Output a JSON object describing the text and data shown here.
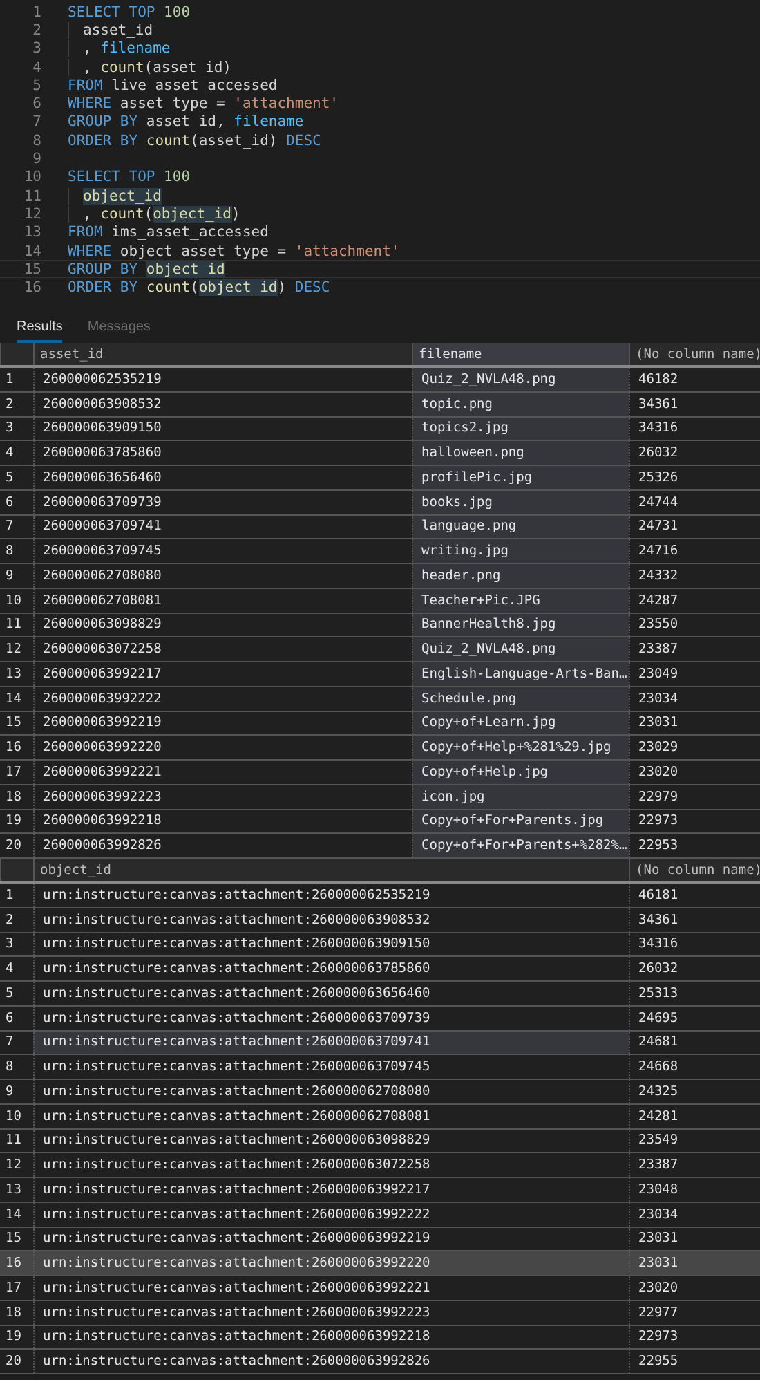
{
  "editor": {
    "lines": [
      {
        "number": "1",
        "current": false,
        "indented": false,
        "tokens": [
          {
            "kind": "kw",
            "text": "SELECT TOP "
          },
          {
            "kind": "num",
            "text": "100"
          }
        ]
      },
      {
        "number": "2",
        "current": false,
        "indented": true,
        "tokens": [
          {
            "kind": "plain",
            "text": "asset_id"
          }
        ]
      },
      {
        "number": "3",
        "current": false,
        "indented": true,
        "tokens": [
          {
            "kind": "plain",
            "text": ", "
          },
          {
            "kind": "col",
            "text": "filename"
          }
        ]
      },
      {
        "number": "4",
        "current": false,
        "indented": true,
        "tokens": [
          {
            "kind": "plain",
            "text": ", "
          },
          {
            "kind": "fn",
            "text": "count"
          },
          {
            "kind": "plain",
            "text": "(asset_id)"
          }
        ]
      },
      {
        "number": "5",
        "current": false,
        "indented": false,
        "tokens": [
          {
            "kind": "kw",
            "text": "FROM"
          },
          {
            "kind": "plain",
            "text": " live_asset_accessed"
          }
        ]
      },
      {
        "number": "6",
        "current": false,
        "indented": false,
        "tokens": [
          {
            "kind": "kw",
            "text": "WHERE"
          },
          {
            "kind": "plain",
            "text": " asset_type = "
          },
          {
            "kind": "str",
            "text": "'attachment'"
          }
        ]
      },
      {
        "number": "7",
        "current": false,
        "indented": false,
        "tokens": [
          {
            "kind": "kw",
            "text": "GROUP BY"
          },
          {
            "kind": "plain",
            "text": " asset_id, "
          },
          {
            "kind": "col",
            "text": "filename"
          }
        ]
      },
      {
        "number": "8",
        "current": false,
        "indented": false,
        "tokens": [
          {
            "kind": "kw",
            "text": "ORDER BY "
          },
          {
            "kind": "fn",
            "text": "count"
          },
          {
            "kind": "plain",
            "text": "(asset_id) "
          },
          {
            "kind": "kw",
            "text": "DESC"
          }
        ]
      },
      {
        "number": "9",
        "current": false
      },
      {
        "number": "10",
        "current": false,
        "indented": false,
        "tokens": [
          {
            "kind": "kw",
            "text": "SELECT TOP "
          },
          {
            "kind": "num",
            "text": "100"
          }
        ]
      },
      {
        "number": "11",
        "current": false,
        "indented": true,
        "tokens": [
          {
            "kind": "ref",
            "text": "object_id"
          }
        ]
      },
      {
        "number": "12",
        "current": false,
        "indented": true,
        "tokens": [
          {
            "kind": "plain",
            "text": ", "
          },
          {
            "kind": "fn",
            "text": "count"
          },
          {
            "kind": "plain",
            "text": "("
          },
          {
            "kind": "ref",
            "text": "object_id"
          },
          {
            "kind": "plain",
            "text": ")"
          }
        ]
      },
      {
        "number": "13",
        "current": false,
        "indented": false,
        "tokens": [
          {
            "kind": "kw",
            "text": "FROM"
          },
          {
            "kind": "plain",
            "text": " ims_asset_accessed"
          }
        ]
      },
      {
        "number": "14",
        "current": false,
        "indented": false,
        "tokens": [
          {
            "kind": "kw",
            "text": "WHERE"
          },
          {
            "kind": "plain",
            "text": " object_asset_type = "
          },
          {
            "kind": "str",
            "text": "'attachment'"
          }
        ]
      },
      {
        "number": "15",
        "current": true,
        "indented": false,
        "tokens": [
          {
            "kind": "kw",
            "text": "GROUP BY "
          },
          {
            "kind": "ref",
            "text": "object_id"
          }
        ]
      },
      {
        "number": "16",
        "current": false,
        "indented": false,
        "tokens": [
          {
            "kind": "kw",
            "text": "ORDER BY "
          },
          {
            "kind": "fn",
            "text": "count"
          },
          {
            "kind": "plain",
            "text": "("
          },
          {
            "kind": "ref",
            "text": "object_id"
          },
          {
            "kind": "plain",
            "text": ") "
          },
          {
            "kind": "kw",
            "text": "DESC"
          }
        ]
      }
    ]
  },
  "result_tabs": [
    {
      "label": "Results",
      "selected": true
    },
    {
      "label": "Messages",
      "selected": false
    }
  ],
  "result_grids": [
    {
      "columns": [
        {
          "label": "asset_id",
          "selected": false
        },
        {
          "label": "filename",
          "selected": true
        },
        {
          "label": "(No column name)",
          "selected": false
        }
      ],
      "rows": [
        {
          "number": "1",
          "selected": false,
          "hovered": false,
          "cells": [
            "260000062535219",
            "Quiz_2_NVLA48.png",
            "46182"
          ]
        },
        {
          "number": "2",
          "selected": false,
          "hovered": false,
          "cells": [
            "260000063908532",
            "topic.png",
            "34361"
          ]
        },
        {
          "number": "3",
          "selected": false,
          "hovered": false,
          "cells": [
            "260000063909150",
            "topics2.jpg",
            "34316"
          ]
        },
        {
          "number": "4",
          "selected": false,
          "hovered": false,
          "cells": [
            "260000063785860",
            "halloween.png",
            "26032"
          ]
        },
        {
          "number": "5",
          "selected": false,
          "hovered": false,
          "cells": [
            "260000063656460",
            "profilePic.jpg",
            "25326"
          ]
        },
        {
          "number": "6",
          "selected": false,
          "hovered": false,
          "cells": [
            "260000063709739",
            "books.jpg",
            "24744"
          ]
        },
        {
          "number": "7",
          "selected": false,
          "hovered": false,
          "cells": [
            "260000063709741",
            "language.png",
            "24731"
          ]
        },
        {
          "number": "8",
          "selected": false,
          "hovered": false,
          "cells": [
            "260000063709745",
            "writing.jpg",
            "24716"
          ]
        },
        {
          "number": "9",
          "selected": false,
          "hovered": false,
          "cells": [
            "260000062708080",
            "header.png",
            "24332"
          ]
        },
        {
          "number": "10",
          "selected": false,
          "hovered": false,
          "cells": [
            "260000062708081",
            "Teacher+Pic.JPG",
            "24287"
          ]
        },
        {
          "number": "11",
          "selected": false,
          "hovered": false,
          "cells": [
            "260000063098829",
            "BannerHealth8.jpg",
            "23550"
          ]
        },
        {
          "number": "12",
          "selected": false,
          "hovered": false,
          "cells": [
            "260000063072258",
            "Quiz_2_NVLA48.png",
            "23387"
          ]
        },
        {
          "number": "13",
          "selected": false,
          "hovered": false,
          "cells": [
            "260000063992217",
            "English-Language-Arts-Ban…",
            "23049"
          ]
        },
        {
          "number": "14",
          "selected": false,
          "hovered": false,
          "cells": [
            "260000063992222",
            "Schedule.png",
            "23034"
          ]
        },
        {
          "number": "15",
          "selected": false,
          "hovered": false,
          "cells": [
            "260000063992219",
            "Copy+of+Learn.jpg",
            "23031"
          ]
        },
        {
          "number": "16",
          "selected": false,
          "hovered": false,
          "cells": [
            "260000063992220",
            "Copy+of+Help+%281%29.jpg",
            "23029"
          ]
        },
        {
          "number": "17",
          "selected": false,
          "hovered": false,
          "cells": [
            "260000063992221",
            "Copy+of+Help.jpg",
            "23020"
          ]
        },
        {
          "number": "18",
          "selected": false,
          "hovered": false,
          "cells": [
            "260000063992223",
            "icon.jpg",
            "22979"
          ]
        },
        {
          "number": "19",
          "selected": false,
          "hovered": false,
          "cells": [
            "260000063992218",
            "Copy+of+For+Parents.jpg",
            "22973"
          ]
        },
        {
          "number": "20",
          "selected": false,
          "hovered": false,
          "cells": [
            "260000063992826",
            "Copy+of+For+Parents+%282%…",
            "22953"
          ]
        }
      ]
    },
    {
      "columns": [
        {
          "label": "object_id",
          "selected": false
        },
        {
          "label": "(No column name)",
          "selected": false
        }
      ],
      "rows": [
        {
          "number": "1",
          "selected": false,
          "hovered": false,
          "cells": [
            "urn:instructure:canvas:attachment:260000062535219",
            "46181"
          ]
        },
        {
          "number": "2",
          "selected": false,
          "hovered": false,
          "cells": [
            "urn:instructure:canvas:attachment:260000063908532",
            "34361"
          ]
        },
        {
          "number": "3",
          "selected": false,
          "hovered": false,
          "cells": [
            "urn:instructure:canvas:attachment:260000063909150",
            "34316"
          ]
        },
        {
          "number": "4",
          "selected": false,
          "hovered": false,
          "cells": [
            "urn:instructure:canvas:attachment:260000063785860",
            "26032"
          ]
        },
        {
          "number": "5",
          "selected": false,
          "hovered": false,
          "cells": [
            "urn:instructure:canvas:attachment:260000063656460",
            "25313"
          ]
        },
        {
          "number": "6",
          "selected": false,
          "hovered": false,
          "cells": [
            "urn:instructure:canvas:attachment:260000063709739",
            "24695"
          ]
        },
        {
          "number": "7",
          "selected": false,
          "hovered": true,
          "cells": [
            "urn:instructure:canvas:attachment:260000063709741",
            "24681"
          ]
        },
        {
          "number": "8",
          "selected": false,
          "hovered": false,
          "cells": [
            "urn:instructure:canvas:attachment:260000063709745",
            "24668"
          ]
        },
        {
          "number": "9",
          "selected": false,
          "hovered": false,
          "cells": [
            "urn:instructure:canvas:attachment:260000062708080",
            "24325"
          ]
        },
        {
          "number": "10",
          "selected": false,
          "hovered": false,
          "cells": [
            "urn:instructure:canvas:attachment:260000062708081",
            "24281"
          ]
        },
        {
          "number": "11",
          "selected": false,
          "hovered": false,
          "cells": [
            "urn:instructure:canvas:attachment:260000063098829",
            "23549"
          ]
        },
        {
          "number": "12",
          "selected": false,
          "hovered": false,
          "cells": [
            "urn:instructure:canvas:attachment:260000063072258",
            "23387"
          ]
        },
        {
          "number": "13",
          "selected": false,
          "hovered": false,
          "cells": [
            "urn:instructure:canvas:attachment:260000063992217",
            "23048"
          ]
        },
        {
          "number": "14",
          "selected": false,
          "hovered": false,
          "cells": [
            "urn:instructure:canvas:attachment:260000063992222",
            "23034"
          ]
        },
        {
          "number": "15",
          "selected": false,
          "hovered": false,
          "cells": [
            "urn:instructure:canvas:attachment:260000063992219",
            "23031"
          ]
        },
        {
          "number": "16",
          "selected": true,
          "hovered": false,
          "cells": [
            "urn:instructure:canvas:attachment:260000063992220",
            "23031"
          ]
        },
        {
          "number": "17",
          "selected": false,
          "hovered": false,
          "cells": [
            "urn:instructure:canvas:attachment:260000063992221",
            "23020"
          ]
        },
        {
          "number": "18",
          "selected": false,
          "hovered": false,
          "cells": [
            "urn:instructure:canvas:attachment:260000063992223",
            "22977"
          ]
        },
        {
          "number": "19",
          "selected": false,
          "hovered": false,
          "cells": [
            "urn:instructure:canvas:attachment:260000063992218",
            "22973"
          ]
        },
        {
          "number": "20",
          "selected": false,
          "hovered": false,
          "cells": [
            "urn:instructure:canvas:attachment:260000063992826",
            "22955"
          ]
        }
      ]
    }
  ]
}
